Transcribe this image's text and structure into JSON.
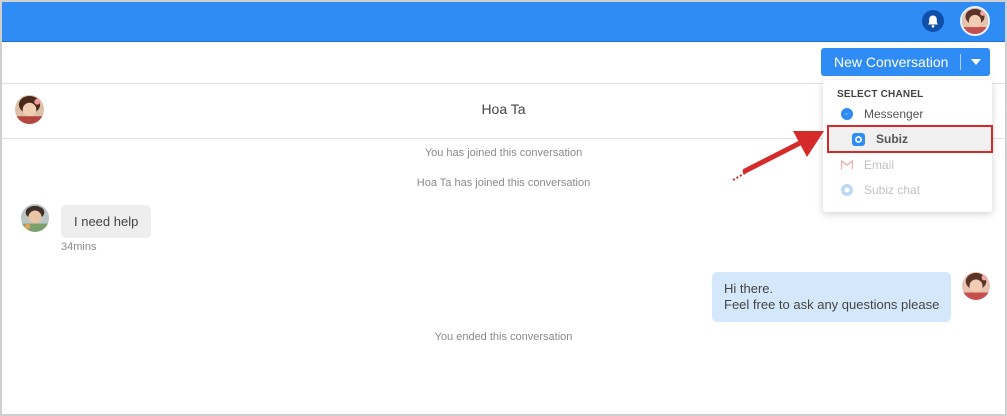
{
  "header": {
    "notification_icon": "bell-icon",
    "user_avatar": "user-avatar"
  },
  "toolbar": {
    "new_conversation_label": "New Conversation",
    "dropdown_icon": "caret-down-icon"
  },
  "conversation": {
    "title": "Hoa Ta",
    "system_messages": [
      "You has joined this conversation",
      "Hoa Ta has joined this conversation",
      "You ended this conversation"
    ],
    "incoming": {
      "text": "I need help",
      "time": "34mins"
    },
    "outgoing": {
      "lines": [
        "Hi there.",
        "Feel free to ask any questions please"
      ]
    }
  },
  "channel_menu": {
    "heading": "SELECT CHANEL",
    "items": [
      {
        "label": "Messenger",
        "icon": "messenger-icon",
        "enabled": true
      },
      {
        "label": "Subiz",
        "icon": "subiz-icon",
        "enabled": true,
        "highlighted": true
      },
      {
        "label": "Email",
        "icon": "gmail-icon",
        "enabled": false
      },
      {
        "label": "Subiz chat",
        "icon": "subiz-chat-icon",
        "enabled": false
      }
    ]
  },
  "colors": {
    "topbar": "#2f8cf5",
    "button": "#2f8cf5",
    "outgoing_bubble": "#d5e8fb",
    "incoming_bubble": "#eeeeee",
    "annotation": "#d42a2a"
  }
}
